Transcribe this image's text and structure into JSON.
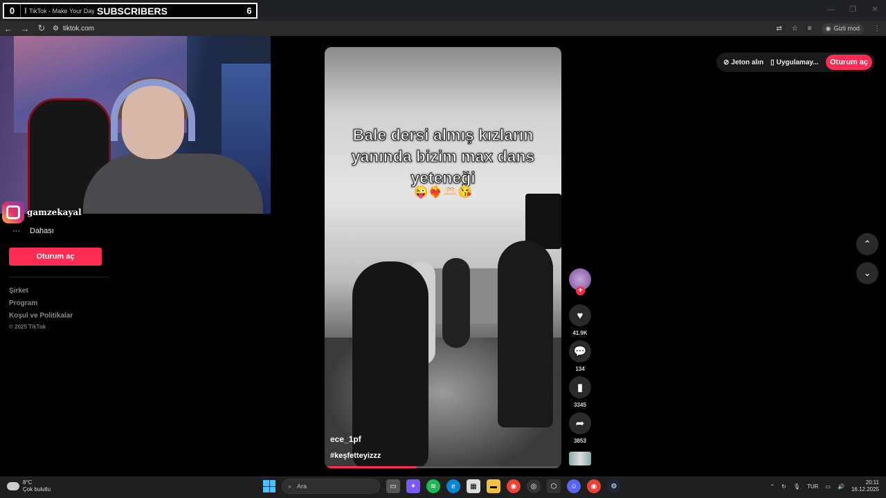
{
  "overlay": {
    "left_count": "0",
    "tab_title": "TikTok - Make Your Day",
    "label": "SUBSCRIBERS",
    "right_count": "6"
  },
  "address_bar": {
    "url": "tiktok.com",
    "incognito_label": "Gizli mod"
  },
  "webcam": {
    "instagram_handle": "gamzekayal"
  },
  "sidebar": {
    "more_label": "Dahası",
    "login_label": "Oturum aç",
    "links": [
      "Şirket",
      "Program",
      "Koşul ve Politikalar"
    ],
    "copyright": "© 2025 TikTok"
  },
  "video": {
    "caption_lines": [
      "Bale dersi almış kızların",
      "yanında bizim max dans",
      "yeteneği"
    ],
    "emojis": "😜❤️‍🔥🫶🏻😘",
    "username": "ece_1pf",
    "hashtag": "#keşfetteyizzz",
    "progress": 0.39
  },
  "actions": {
    "likes": "41.9K",
    "comments": "134",
    "saves": "3345",
    "shares": "3853"
  },
  "top_bar": {
    "coins_label": "Jeton alın",
    "app_label": "Uygulamay...",
    "login_label": "Oturum aç"
  },
  "taskbar": {
    "weather_temp": "8°C",
    "weather_desc": "Çok bulutlu",
    "search_placeholder": "Ara",
    "language": "TUR",
    "time": "20:11",
    "date": "16.12.2025"
  },
  "colors": {
    "accent": "#fe2c55",
    "background": "#000000"
  }
}
